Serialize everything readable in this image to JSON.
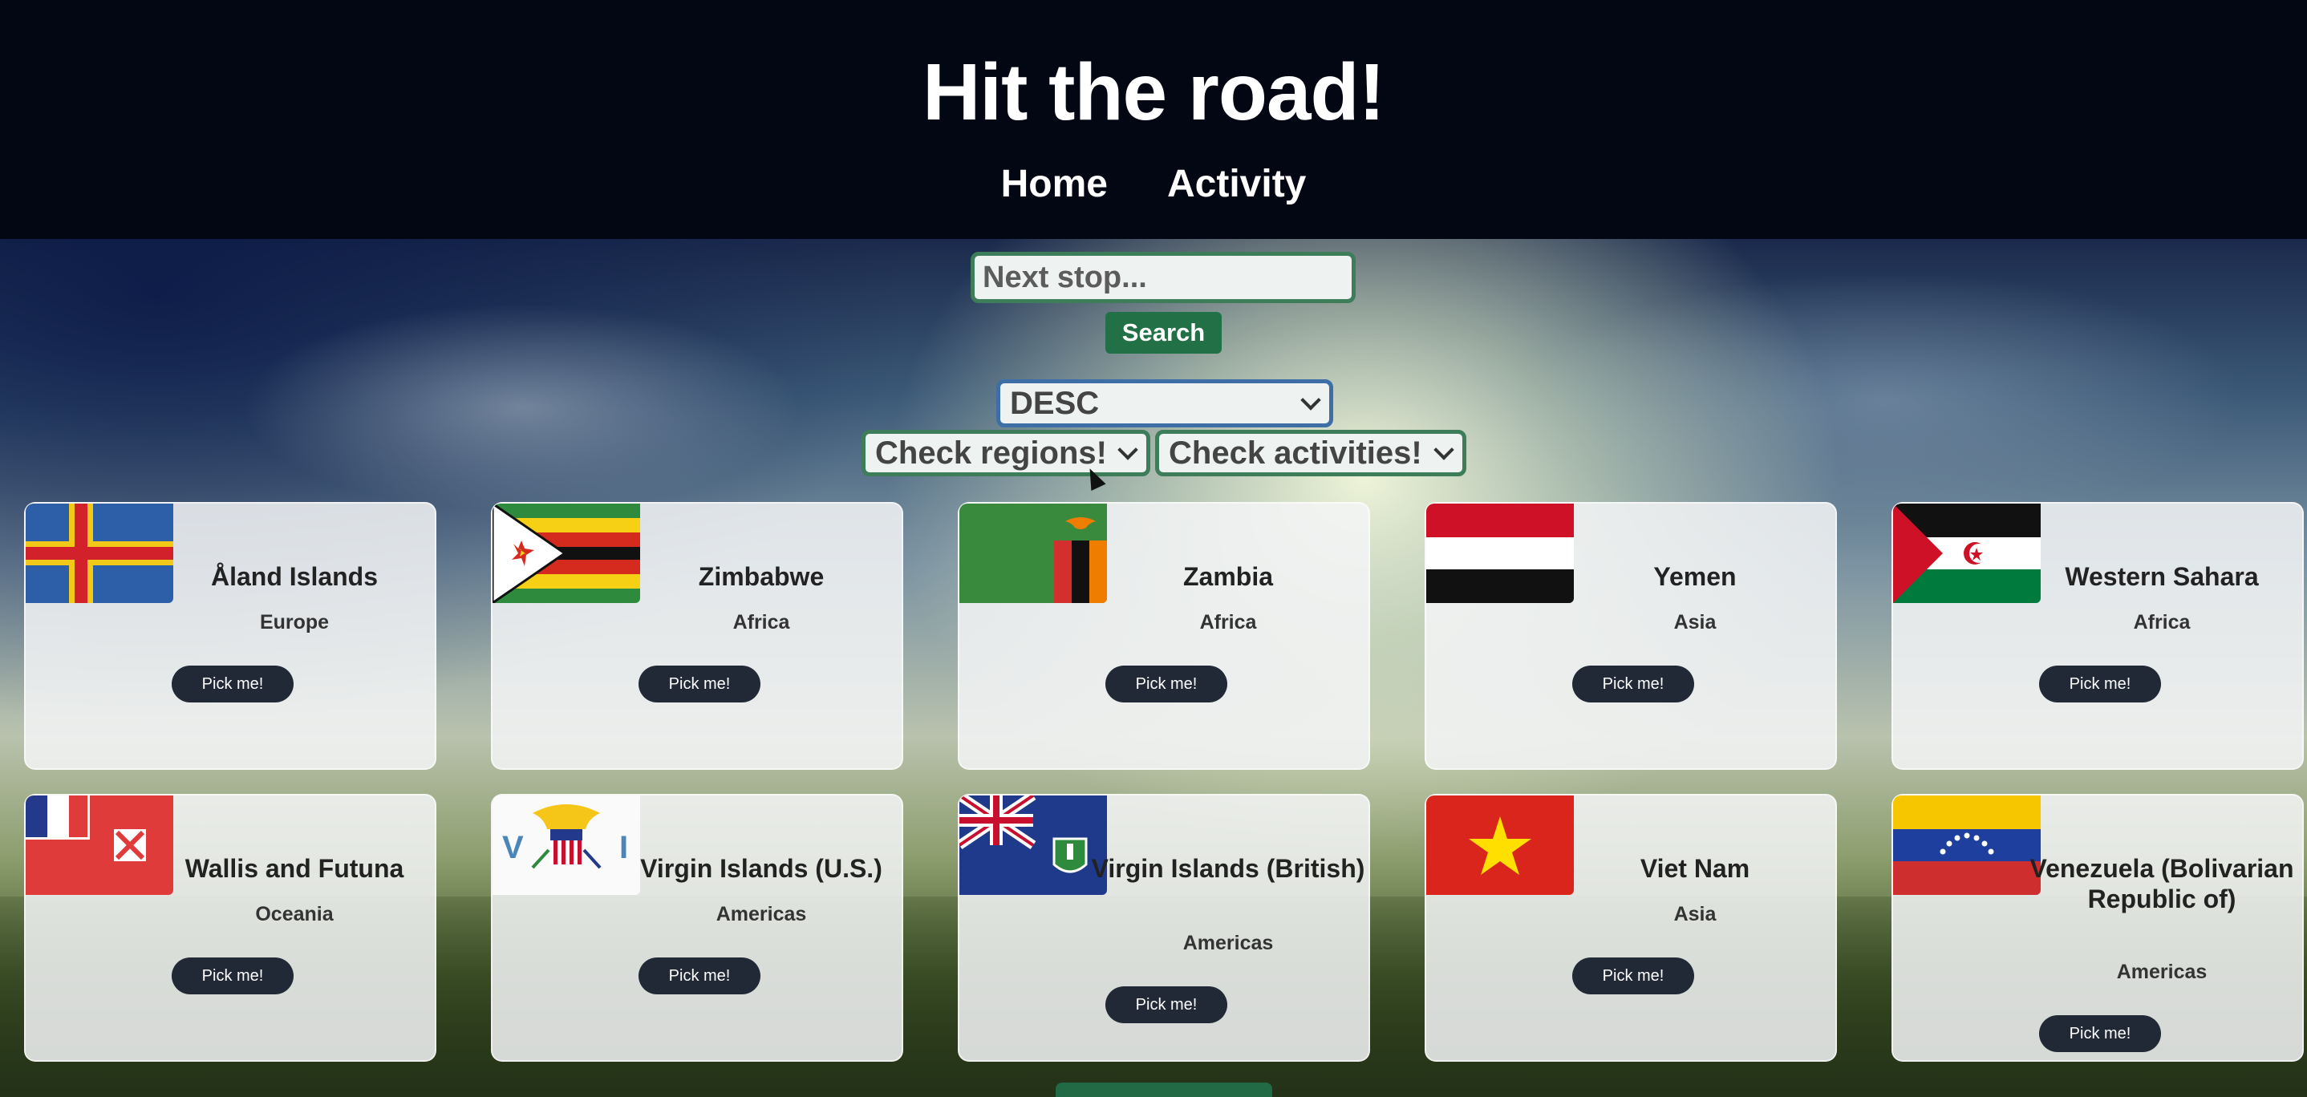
{
  "header": {
    "title": "Hit the road!",
    "nav": [
      "Home",
      "Activity"
    ]
  },
  "search": {
    "placeholder": "Next stop...",
    "button": "Search"
  },
  "filters": {
    "sort": "DESC",
    "regions": "Check regions!",
    "activities": "Check activities!"
  },
  "pick_label": "Pick me!",
  "countries": [
    {
      "name": "Åland Islands",
      "region": "Europe",
      "flag": "aland-flag"
    },
    {
      "name": "Zimbabwe",
      "region": "Africa",
      "flag": "zimbabwe-flag"
    },
    {
      "name": "Zambia",
      "region": "Africa",
      "flag": "zambia-flag"
    },
    {
      "name": "Yemen",
      "region": "Asia",
      "flag": "yemen-flag"
    },
    {
      "name": "Western Sahara",
      "region": "Africa",
      "flag": "western-sahara-flag"
    },
    {
      "name": "Wallis and Futuna",
      "region": "Oceania",
      "flag": "wallis-futuna-flag"
    },
    {
      "name": "Virgin Islands (U.S.)",
      "region": "Americas",
      "flag": "us-virgin-islands-flag"
    },
    {
      "name": "Virgin Islands (British)",
      "region": "Americas",
      "flag": "british-virgin-islands-flag"
    },
    {
      "name": "Viet Nam",
      "region": "Asia",
      "flag": "vietnam-flag"
    },
    {
      "name": "Venezuela (Bolivarian Republic of)",
      "region": "Americas",
      "flag": "venezuela-flag"
    }
  ],
  "colors": {
    "header_bg": "#030714",
    "accent_green": "#227046",
    "pick_button": "#212936",
    "sort_border": "#3d6fa6"
  }
}
